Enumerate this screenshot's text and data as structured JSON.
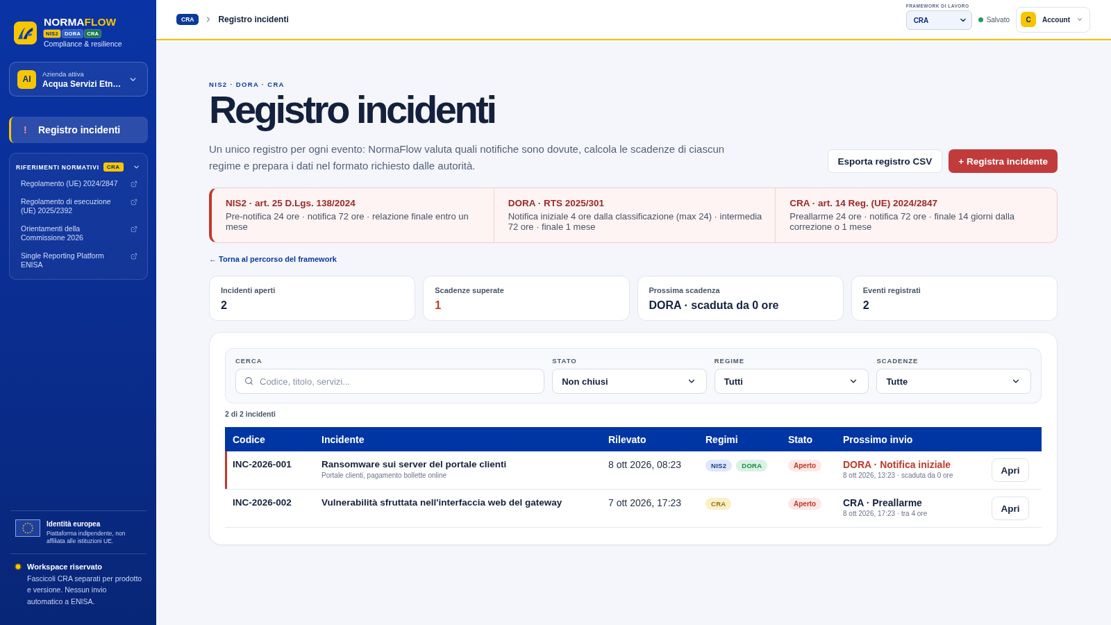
{
  "sidebar": {
    "brand": {
      "name": "NORMA",
      "accent": "FLOW",
      "badges": [
        {
          "label": "NIS2",
          "color": "#f7c600"
        },
        {
          "label": "DORA",
          "color": "#2e5fc7"
        },
        {
          "label": "CRA",
          "color": "#1c7a4a"
        }
      ],
      "tagline": "Compliance & resilience"
    },
    "company": {
      "initials": "AI",
      "label": "Azienda attiva",
      "name": "Acqua Servizi Etn…"
    },
    "nav": [
      {
        "icon": "!",
        "label": "Registro incidenti",
        "selected": true
      }
    ],
    "references": {
      "title": "RIFERIMENTI NORMATIVI",
      "badge": "CRA",
      "expanded": true,
      "links": [
        "Regolamento (UE) 2024/2847",
        "Regolamento di esecuzione (UE) 2025/2392",
        "Orientamenti della Commissione 2026",
        "Single Reporting Platform ENISA"
      ]
    },
    "identity": {
      "title": "Identità europea",
      "text": "Piattaforma indipendente, non affiliata alle istituzioni UE."
    },
    "workspace": {
      "title": "Workspace riservato",
      "text": "Fascicoli CRA separati per prodotto e versione. Nessun invio automatico a ENISA."
    }
  },
  "topbar": {
    "breadcrumb": [
      {
        "kind": "link",
        "label": "CRA"
      },
      {
        "kind": "current",
        "label": "Registro incidenti"
      }
    ],
    "framework": {
      "label": "FRAMEWORK DI LAVORO",
      "value": "CRA"
    },
    "save_status": "Salvato",
    "account": {
      "initial": "C",
      "label": "Account"
    }
  },
  "page": {
    "eyebrow": "NIS2 · DORA · CRA",
    "title": "Registro incidenti",
    "description": "Un unico registro per ogni evento: NormaFlow valuta quali notifiche sono dovute, calcola le scadenze di ciascun regime e prepara i dati nel formato richiesto dalle autorità.",
    "actions": [
      {
        "kind": "secondary",
        "label": "Esporta registro CSV"
      },
      {
        "kind": "primary",
        "label": "+ Registra incidente"
      }
    ],
    "regimes": [
      {
        "title": "NIS2 · art. 25 D.Lgs. 138/2024",
        "text": "Pre-notifica 24 ore · notifica 72 ore · relazione finale entro un mese"
      },
      {
        "title": "DORA · RTS 2025/301",
        "text": "Notifica iniziale 4 ore dalla classificazione (max 24) · intermedia 72 ore · finale 1 mese"
      },
      {
        "title": "CRA · art. 14 Reg. (UE) 2024/2847",
        "text": "Preallarme 24 ore · notifica 72 ore · finale 14 giorni dalla correzione o 1 mese"
      }
    ],
    "back_link": "← Torna al percorso del framework",
    "stats": [
      {
        "label": "Incidenti aperti",
        "value": "2",
        "alert": false
      },
      {
        "label": "Scadenze superate",
        "value": "1",
        "alert": true
      },
      {
        "label": "Prossima scadenza",
        "value": "DORA · scaduta da 0 ore",
        "alert": false
      },
      {
        "label": "Eventi registrati",
        "value": "2",
        "alert": false
      }
    ],
    "filters": [
      {
        "kind": "search",
        "label": "CERCA",
        "placeholder": "Codice, titolo, servizi..."
      },
      {
        "kind": "select",
        "label": "STATO",
        "value": "Non chiusi"
      },
      {
        "kind": "select",
        "label": "REGIME",
        "value": "Tutti"
      },
      {
        "kind": "select",
        "label": "SCADENZE",
        "value": "Tutte"
      }
    ],
    "result_count": "2 di 2 incidenti",
    "table": {
      "columns": [
        "Codice",
        "Incidente",
        "Rilevato",
        "Regimi",
        "Stato",
        "Prossimo invio"
      ],
      "rows": [
        {
          "code": "INC-2026-001",
          "title": "Ransomware sui server del portale clienti",
          "subtitle": "Portale clienti, pagamento bollette online",
          "detected": "8 ott 2026, 08:23",
          "regimes": [
            {
              "label": "NIS2",
              "color": "#dfe7fb"
            },
            {
              "label": "DORA",
              "color": "#daf1e3"
            }
          ],
          "status": "Aperto",
          "next_title": "DORA · Notifica iniziale",
          "next_detail": "8 ott 2026, 13:23 · scaduta da 0 ore",
          "overdue": true,
          "action": "Apri"
        },
        {
          "code": "INC-2026-002",
          "title": "Vulnerabilità sfruttata nell'interfaccia web del gateway",
          "detected": "7 ott 2026, 17:23",
          "regimes": [
            {
              "label": "CRA",
              "color": "#fcefc4"
            }
          ],
          "status": "Aperto",
          "next_title": "CRA · Preallarme",
          "next_detail": "8 ott 2026, 17:23 · tra 4 ore",
          "overdue": false,
          "action": "Apri"
        }
      ]
    }
  }
}
